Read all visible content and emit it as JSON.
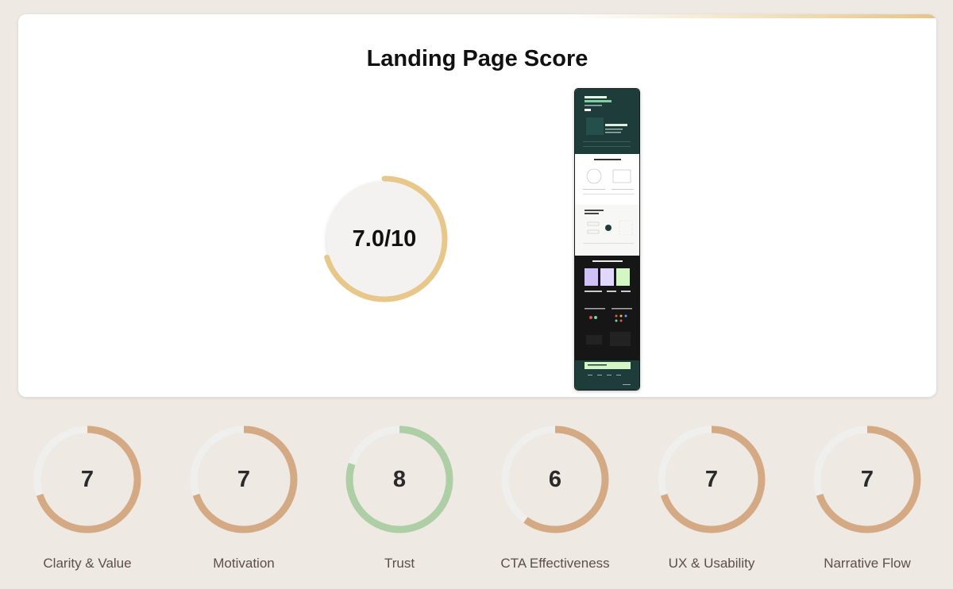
{
  "header": {
    "title": "Landing Page Score"
  },
  "overall": {
    "score_text": "7.0/10",
    "score": 7.0,
    "max": 10,
    "color": "#e7c88a",
    "track_color": "#f3f2f1"
  },
  "thumbnail": {
    "icon": "landing-page-screenshot"
  },
  "metrics": [
    {
      "label": "Clarity & Value",
      "value": "7",
      "score": 7,
      "color": "#d4aa84"
    },
    {
      "label": "Motivation",
      "value": "7",
      "score": 7,
      "color": "#d4aa84"
    },
    {
      "label": "Trust",
      "value": "8",
      "score": 8,
      "color": "#aecfa5"
    },
    {
      "label": "CTA Effectiveness",
      "value": "6",
      "score": 6,
      "color": "#d4aa84"
    },
    {
      "label": "UX & Usability",
      "value": "7",
      "score": 7,
      "color": "#d4aa84"
    },
    {
      "label": "Narrative Flow",
      "value": "7",
      "score": 7,
      "color": "#d4aa84"
    }
  ],
  "metric_max": 10,
  "metric_track_color": "#efefee"
}
